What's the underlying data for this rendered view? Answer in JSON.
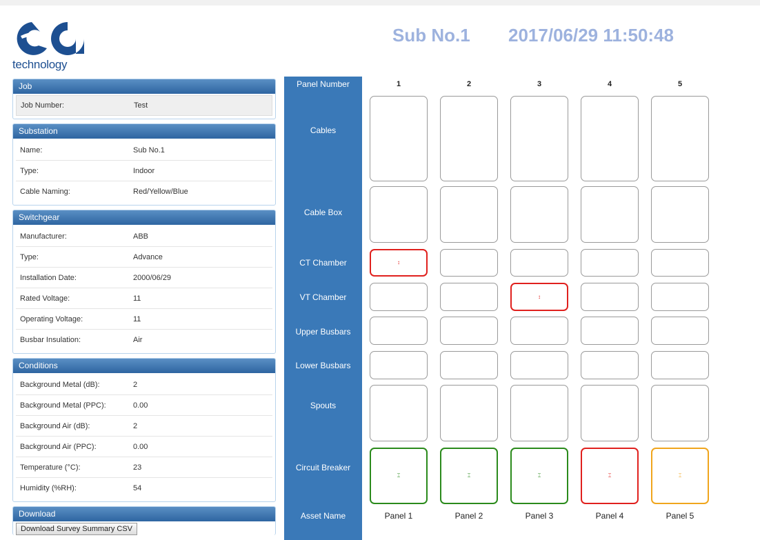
{
  "logo": {
    "letters": "ea",
    "text": "technology"
  },
  "header": {
    "substation": "Sub No.1",
    "timestamp": "2017/06/29 11:50:48"
  },
  "job": {
    "title": "Job",
    "rows": [
      {
        "label": "Job Number:",
        "value": "Test"
      }
    ]
  },
  "substation": {
    "title": "Substation",
    "rows": [
      {
        "label": "Name:",
        "value": "Sub No.1"
      },
      {
        "label": "Type:",
        "value": "Indoor"
      },
      {
        "label": "Cable Naming:",
        "value": "Red/Yellow/Blue"
      }
    ]
  },
  "switchgear": {
    "title": "Switchgear",
    "rows": [
      {
        "label": "Manufacturer:",
        "value": "ABB"
      },
      {
        "label": "Type:",
        "value": "Advance"
      },
      {
        "label": "Installation Date:",
        "value": "2000/06/29"
      },
      {
        "label": "Rated Voltage:",
        "value": "11"
      },
      {
        "label": "Operating Voltage:",
        "value": "11"
      },
      {
        "label": "Busbar Insulation:",
        "value": "Air"
      }
    ]
  },
  "conditions": {
    "title": "Conditions",
    "rows": [
      {
        "label": "Background Metal (dB):",
        "value": "2"
      },
      {
        "label": "Background Metal (PPC):",
        "value": "0.00"
      },
      {
        "label": "Background Air (dB):",
        "value": "2"
      },
      {
        "label": "Background Air (PPC):",
        "value": "0.00"
      },
      {
        "label": "Temperature (°C):",
        "value": "23"
      },
      {
        "label": "Humidity (%RH):",
        "value": "54"
      }
    ]
  },
  "download": {
    "title": "Download",
    "button": "Download Survey Summary CSV"
  },
  "grid": {
    "row_labels": {
      "panel_number": "Panel Number",
      "cables": "Cables",
      "cable_box": "Cable Box",
      "ct_chamber": "CT Chamber",
      "vt_chamber": "VT Chamber",
      "upper_busbars": "Upper Busbars",
      "lower_busbars": "Lower Busbars",
      "spouts": "Spouts",
      "circuit_breaker": "Circuit Breaker",
      "asset_name": "Asset Name"
    },
    "panel_numbers": [
      "1",
      "2",
      "3",
      "4",
      "5"
    ],
    "asset_names": [
      "Panel 1",
      "Panel 2",
      "Panel 3",
      "Panel 4",
      "Panel 5"
    ],
    "ct_status": [
      "red",
      "",
      "",
      "",
      ""
    ],
    "vt_status": [
      "",
      "",
      "red",
      "",
      ""
    ],
    "cb_status": [
      "green",
      "green",
      "green",
      "red",
      "orange"
    ],
    "ct_marker": "↕",
    "vt_marker": "↕",
    "cb_marker": "⌶",
    "colors": {
      "red": "#e0201d",
      "green": "#2a8a1b",
      "orange": "#f0a51c",
      "bar": "#3a79b8",
      "header": "#9db2de"
    }
  }
}
